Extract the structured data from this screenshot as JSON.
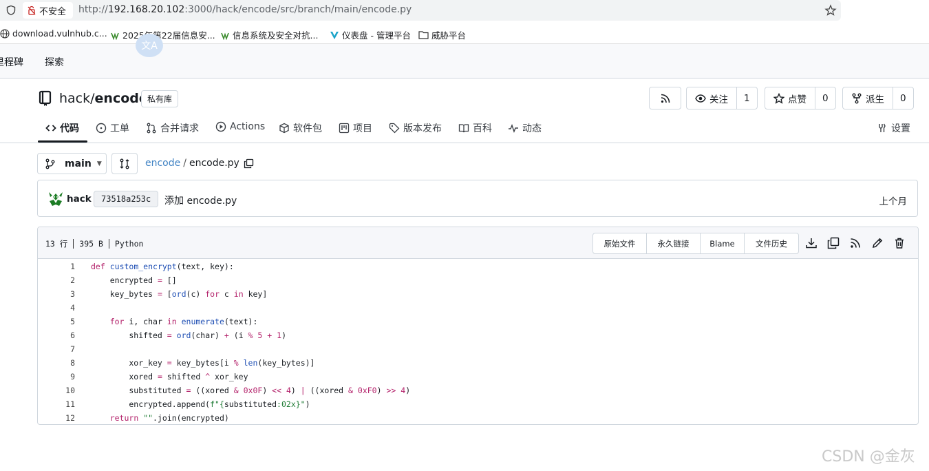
{
  "browser": {
    "insecure_label": "不安全",
    "url_prefix": "http://",
    "url_host": "192.168.20.102",
    "url_rest": ":3000/hack/encode/src/branch/main/encode.py",
    "bookmarks": [
      {
        "label": "download.vulnhub.c...",
        "icon": "globe-icon"
      },
      {
        "label": "2025年第22届信息安...",
        "icon": "site-icon"
      },
      {
        "label": "信息系统及安全对抗...",
        "icon": "site-icon"
      },
      {
        "label": "仪表盘 - 管理平台",
        "icon": "v-logo-icon"
      },
      {
        "label": "威胁平台",
        "icon": "folder-icon"
      }
    ]
  },
  "topnav": {
    "items": [
      "里程碑",
      "探索"
    ],
    "avatar_text": "文A"
  },
  "repo": {
    "owner": "hack",
    "separator": "/",
    "name": "encode",
    "private_label": "私有库",
    "watch_label": "关注",
    "watch_count": "1",
    "star_label": "点赞",
    "star_count": "0",
    "fork_label": "派生",
    "fork_count": "0"
  },
  "tabs": [
    {
      "label": "代码",
      "icon": "code-icon",
      "active": true
    },
    {
      "label": "工单",
      "icon": "issue-icon"
    },
    {
      "label": "合并请求",
      "icon": "pull-request-icon"
    },
    {
      "label": "Actions",
      "icon": "play-icon"
    },
    {
      "label": "软件包",
      "icon": "package-icon"
    },
    {
      "label": "项目",
      "icon": "project-icon"
    },
    {
      "label": "版本发布",
      "icon": "tag-icon"
    },
    {
      "label": "百科",
      "icon": "book-icon"
    },
    {
      "label": "动态",
      "icon": "pulse-icon"
    },
    {
      "label": "设置",
      "icon": "tools-icon"
    }
  ],
  "branch": {
    "name": "main",
    "crumb_repo": "encode",
    "crumb_sep": "/",
    "crumb_file": "encode.py"
  },
  "commit": {
    "author": "hack",
    "sha": "73518a253c",
    "message": "添加 encode.py",
    "time": "上个月"
  },
  "file": {
    "lines_info": "13 行",
    "size": "395 B",
    "language": "Python",
    "actions": [
      "原始文件",
      "永久链接",
      "Blame",
      "文件历史"
    ],
    "code": [
      {
        "n": "1",
        "html": "<span class=\"kw\">def</span> <span class=\"fn\">custom_encrypt</span>(text, key):"
      },
      {
        "n": "2",
        "html": "    encrypted <span class=\"op\">=</span> []"
      },
      {
        "n": "3",
        "html": "    key_bytes <span class=\"op\">=</span> [<span class=\"bi\">ord</span>(c) <span class=\"kw\">for</span> c <span class=\"kw\">in</span> key]"
      },
      {
        "n": "4",
        "html": ""
      },
      {
        "n": "5",
        "html": "    <span class=\"kw\">for</span> i, char <span class=\"kw\">in</span> <span class=\"bi\">enumerate</span>(text):"
      },
      {
        "n": "6",
        "html": "        shifted <span class=\"op\">=</span> <span class=\"bi\">ord</span>(char) <span class=\"op\">+</span> (i <span class=\"op\">%</span> <span class=\"num\">5</span> <span class=\"op\">+</span> <span class=\"num\">1</span>)"
      },
      {
        "n": "7",
        "html": ""
      },
      {
        "n": "8",
        "html": "        xor_key <span class=\"op\">=</span> key_bytes[i <span class=\"op\">%</span> <span class=\"bi\">len</span>(key_bytes)]"
      },
      {
        "n": "9",
        "html": "        xored <span class=\"op\">=</span> shifted <span class=\"op\">^</span> xor_key"
      },
      {
        "n": "10",
        "html": "        substituted <span class=\"op\">=</span> ((xored <span class=\"op\">&amp;</span> <span class=\"num\">0x0F</span>) <span class=\"op\">&lt;&lt;</span> <span class=\"num\">4</span>) <span class=\"op\">|</span> ((xored <span class=\"op\">&amp;</span> <span class=\"num\">0xF0</span>) <span class=\"op\">&gt;&gt;</span> <span class=\"num\">4</span>)"
      },
      {
        "n": "11",
        "html": "        encrypted.append(<span class=\"str\">f\"{</span>substituted<span class=\"str\">:02x}\"</span>)"
      },
      {
        "n": "12",
        "html": "    <span class=\"kw\">return</span> <span class=\"str\">\"\"</span>.join(encrypted)"
      }
    ]
  },
  "watermark": "CSDN @金灰"
}
